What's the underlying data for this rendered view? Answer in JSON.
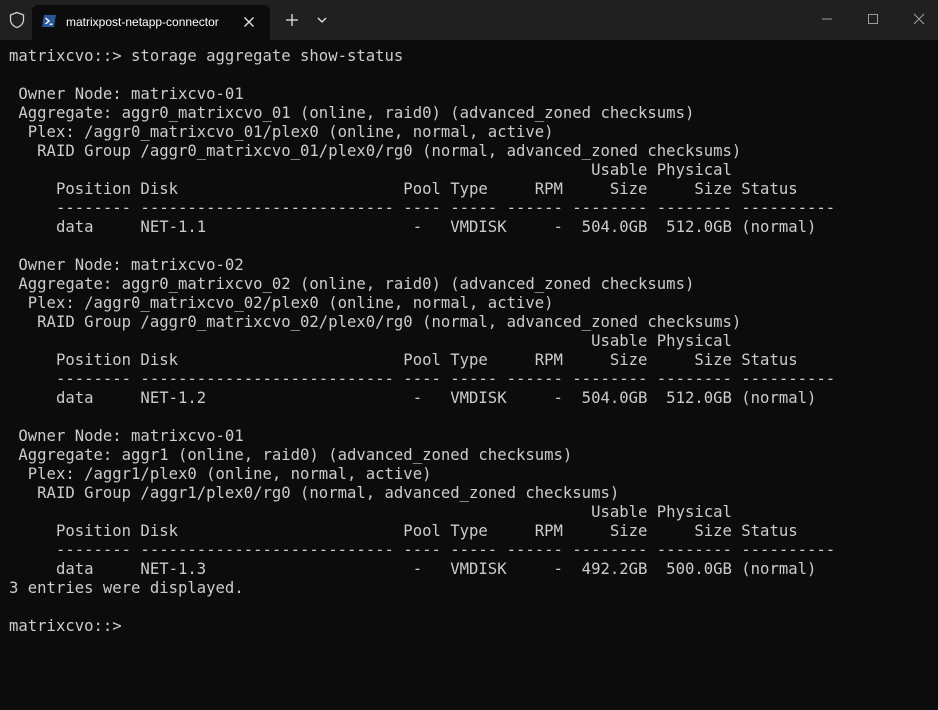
{
  "window": {
    "tab_title": "matrixpost-netapp-connector",
    "tab_icon": "powershell-icon",
    "colors": {
      "titlebar": "#202020",
      "terminal_bg": "#0c0c0c",
      "text": "#cccccc",
      "tab_icon_bg": "#2b579a"
    }
  },
  "terminal": {
    "lines": [
      "matrixcvo::> storage aggregate show-status",
      "",
      " Owner Node: matrixcvo-01",
      " Aggregate: aggr0_matrixcvo_01 (online, raid0) (advanced_zoned checksums)",
      "  Plex: /aggr0_matrixcvo_01/plex0 (online, normal, active)",
      "   RAID Group /aggr0_matrixcvo_01/plex0/rg0 (normal, advanced_zoned checksums)",
      "                                                              Usable Physical",
      "     Position Disk                        Pool Type     RPM     Size     Size Status",
      "     -------- --------------------------- ---- ----- ------ -------- -------- ----------",
      "     data     NET-1.1                      -   VMDISK     -  504.0GB  512.0GB (normal)",
      "",
      " Owner Node: matrixcvo-02",
      " Aggregate: aggr0_matrixcvo_02 (online, raid0) (advanced_zoned checksums)",
      "  Plex: /aggr0_matrixcvo_02/plex0 (online, normal, active)",
      "   RAID Group /aggr0_matrixcvo_02/plex0/rg0 (normal, advanced_zoned checksums)",
      "                                                              Usable Physical",
      "     Position Disk                        Pool Type     RPM     Size     Size Status",
      "     -------- --------------------------- ---- ----- ------ -------- -------- ----------",
      "     data     NET-1.2                      -   VMDISK     -  504.0GB  512.0GB (normal)",
      "",
      " Owner Node: matrixcvo-01",
      " Aggregate: aggr1 (online, raid0) (advanced_zoned checksums)",
      "  Plex: /aggr1/plex0 (online, normal, active)",
      "   RAID Group /aggr1/plex0/rg0 (normal, advanced_zoned checksums)",
      "                                                              Usable Physical",
      "     Position Disk                        Pool Type     RPM     Size     Size Status",
      "     -------- --------------------------- ---- ----- ------ -------- -------- ----------",
      "     data     NET-1.3                      -   VMDISK     -  492.2GB  500.0GB (normal)",
      "3 entries were displayed.",
      "",
      "matrixcvo::> "
    ]
  }
}
